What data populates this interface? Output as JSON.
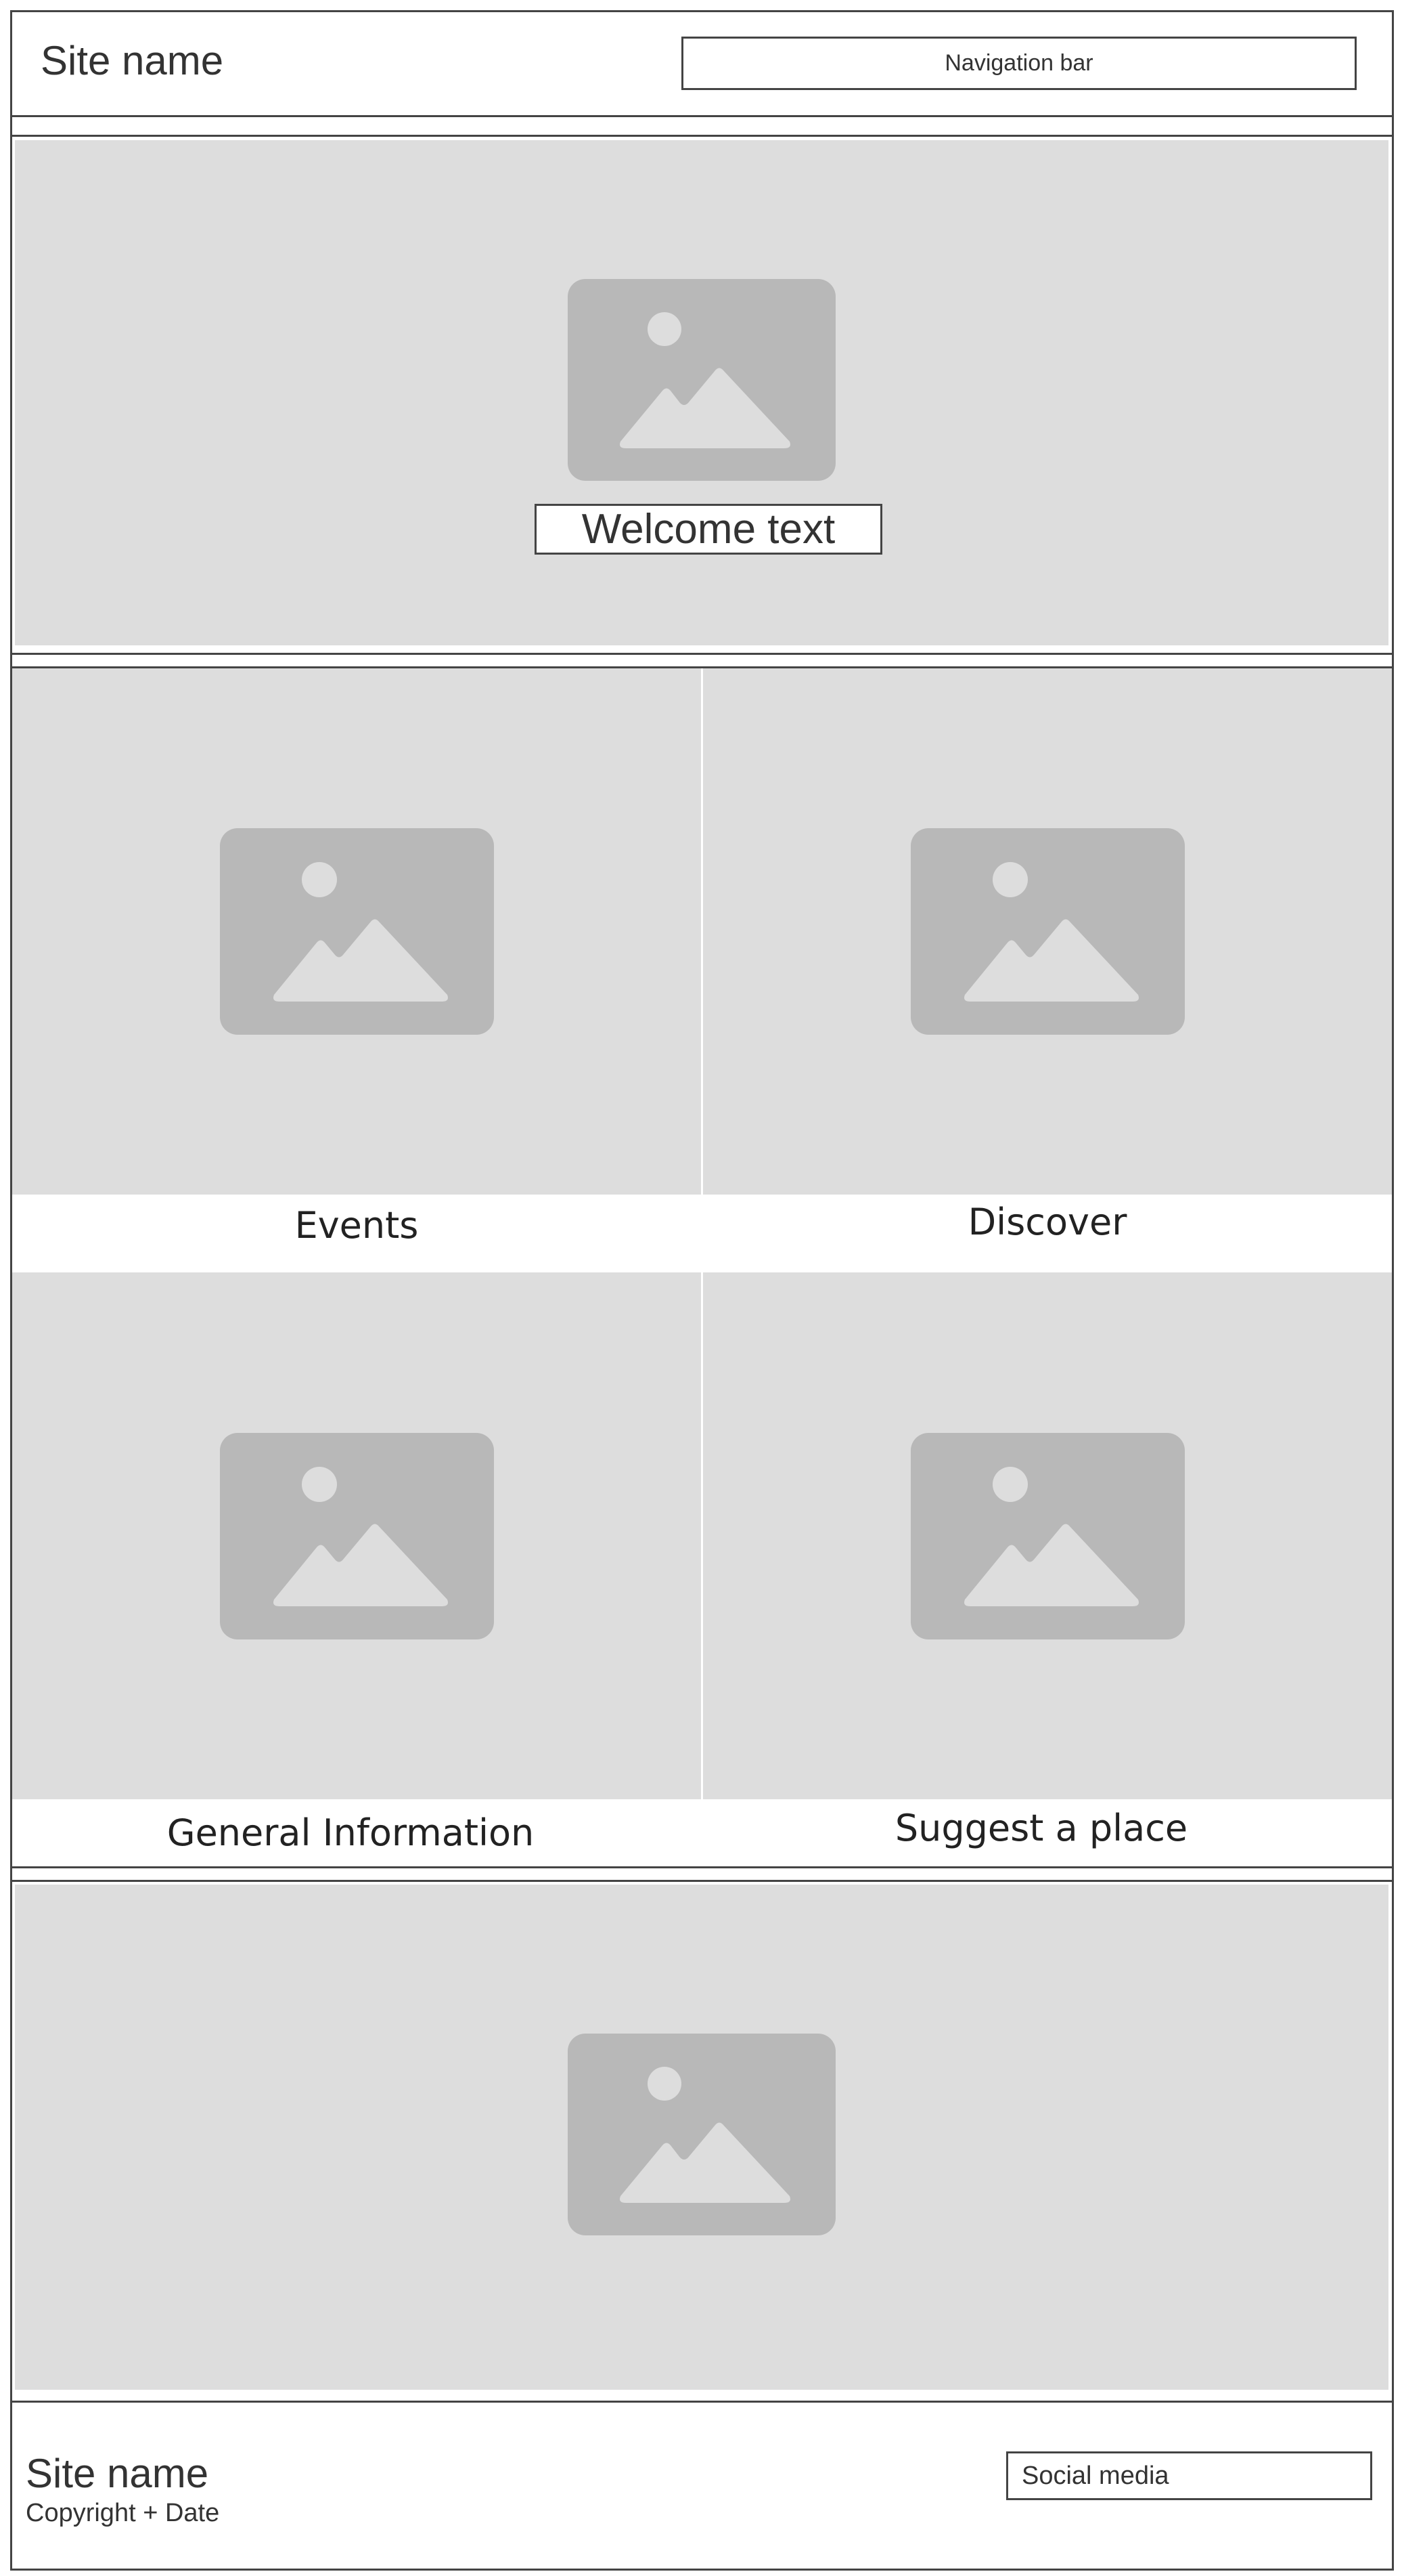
{
  "header": {
    "site_name": "Site name",
    "nav_label": "Navigation bar"
  },
  "hero": {
    "image_icon": "image-placeholder-icon",
    "welcome_text": "Welcome text"
  },
  "tiles": [
    {
      "label": "Events",
      "image_icon": "image-placeholder-icon"
    },
    {
      "label": "Discover",
      "image_icon": "image-placeholder-icon"
    },
    {
      "label": "General Information",
      "image_icon": "image-placeholder-icon"
    },
    {
      "label": "Suggest a place",
      "image_icon": "image-placeholder-icon"
    }
  ],
  "banner": {
    "image_icon": "image-placeholder-icon"
  },
  "footer": {
    "site_name": "Site name",
    "copyright": "Copyright + Date",
    "social_label": "Social media"
  },
  "colors": {
    "placeholder_bg": "#dddddd",
    "icon_fill": "#b8b8b8",
    "icon_cutout": "#dddddd",
    "border": "#444444",
    "text": "#333333"
  }
}
